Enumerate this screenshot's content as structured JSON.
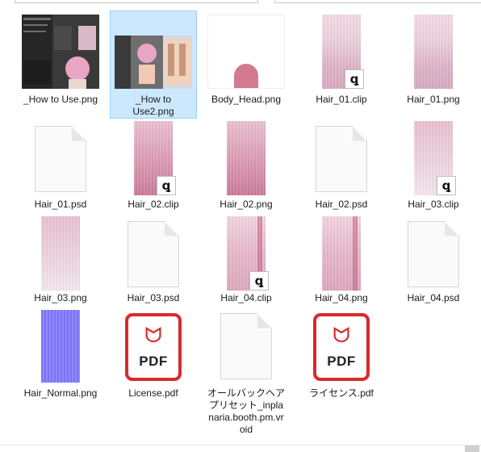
{
  "files": [
    {
      "name": "_How to Use.png",
      "kind": "screenshot"
    },
    {
      "name": "_How to Use2.png",
      "kind": "screenshot2",
      "selected": true
    },
    {
      "name": "Body_Head.png",
      "kind": "bodyhead"
    },
    {
      "name": "Hair_01.clip",
      "kind": "clip"
    },
    {
      "name": "Hair_01.png",
      "kind": "hair"
    },
    {
      "name": "Hair_01.psd",
      "kind": "doc"
    },
    {
      "name": "Hair_02.clip",
      "kind": "clip"
    },
    {
      "name": "Hair_02.png",
      "kind": "hair"
    },
    {
      "name": "Hair_02.psd",
      "kind": "doc"
    },
    {
      "name": "Hair_03.clip",
      "kind": "clip"
    },
    {
      "name": "Hair_03.png",
      "kind": "hair"
    },
    {
      "name": "Hair_03.psd",
      "kind": "doc"
    },
    {
      "name": "Hair_04.clip",
      "kind": "clip"
    },
    {
      "name": "Hair_04.png",
      "kind": "hair"
    },
    {
      "name": "Hair_04.psd",
      "kind": "doc"
    },
    {
      "name": "Hair_Normal.png",
      "kind": "normal"
    },
    {
      "name": "License.pdf",
      "kind": "pdf"
    },
    {
      "name": "オールバックヘアプリセット_inplanaria.booth.pm.vroid",
      "kind": "doc"
    },
    {
      "name": "ライセンス.pdf",
      "kind": "pdf"
    }
  ],
  "pdf_badge_text": "PDF",
  "clip_badge_text": "ꝗ",
  "colors": {
    "selection": "#cce8ff",
    "pdf_red": "#d92a2a",
    "normal_map": "#7b73f5",
    "hair_pink": "#d48ba7"
  }
}
